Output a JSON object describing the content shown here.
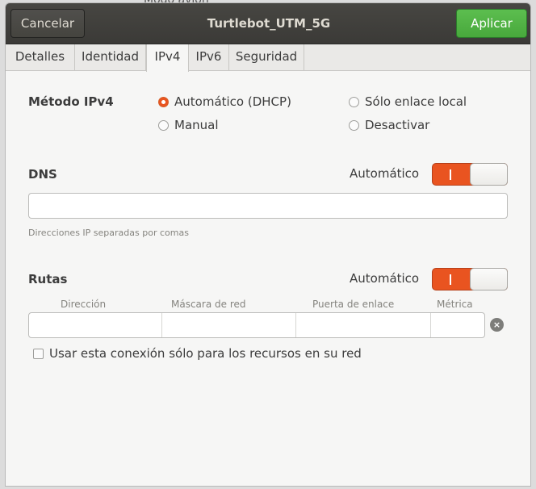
{
  "background": {
    "partial_text": "Modo avión"
  },
  "header": {
    "cancel_label": "Cancelar",
    "title": "Turtlebot_UTM_5G",
    "apply_label": "Aplicar"
  },
  "tabs": [
    {
      "label": "Detalles",
      "active": false
    },
    {
      "label": "Identidad",
      "active": false
    },
    {
      "label": "IPv4",
      "active": true
    },
    {
      "label": "IPv6",
      "active": false
    },
    {
      "label": "Seguridad",
      "active": false
    }
  ],
  "ipv4_method": {
    "label": "Método IPv4",
    "options": [
      {
        "label": "Automático (DHCP)",
        "checked": true
      },
      {
        "label": "Sólo enlace local",
        "checked": false
      },
      {
        "label": "Manual",
        "checked": false
      },
      {
        "label": "Desactivar",
        "checked": false
      }
    ]
  },
  "dns": {
    "label": "DNS",
    "auto_label": "Automático",
    "auto_enabled": true,
    "value": "",
    "hint": "Direcciones IP separadas por comas"
  },
  "routes": {
    "label": "Rutas",
    "auto_label": "Automático",
    "auto_enabled": true,
    "columns": [
      "Dirección",
      "Máscara de red",
      "Puerta de enlace",
      "Métrica"
    ],
    "only_local_label": "Usar esta conexión sólo para los recursos en su red",
    "only_local_checked": false
  },
  "colors": {
    "accent": "#e95420",
    "apply_green": "#4fb344",
    "headerbar": "#41403c"
  },
  "icons": {
    "clear_row": "x-circle-icon"
  }
}
